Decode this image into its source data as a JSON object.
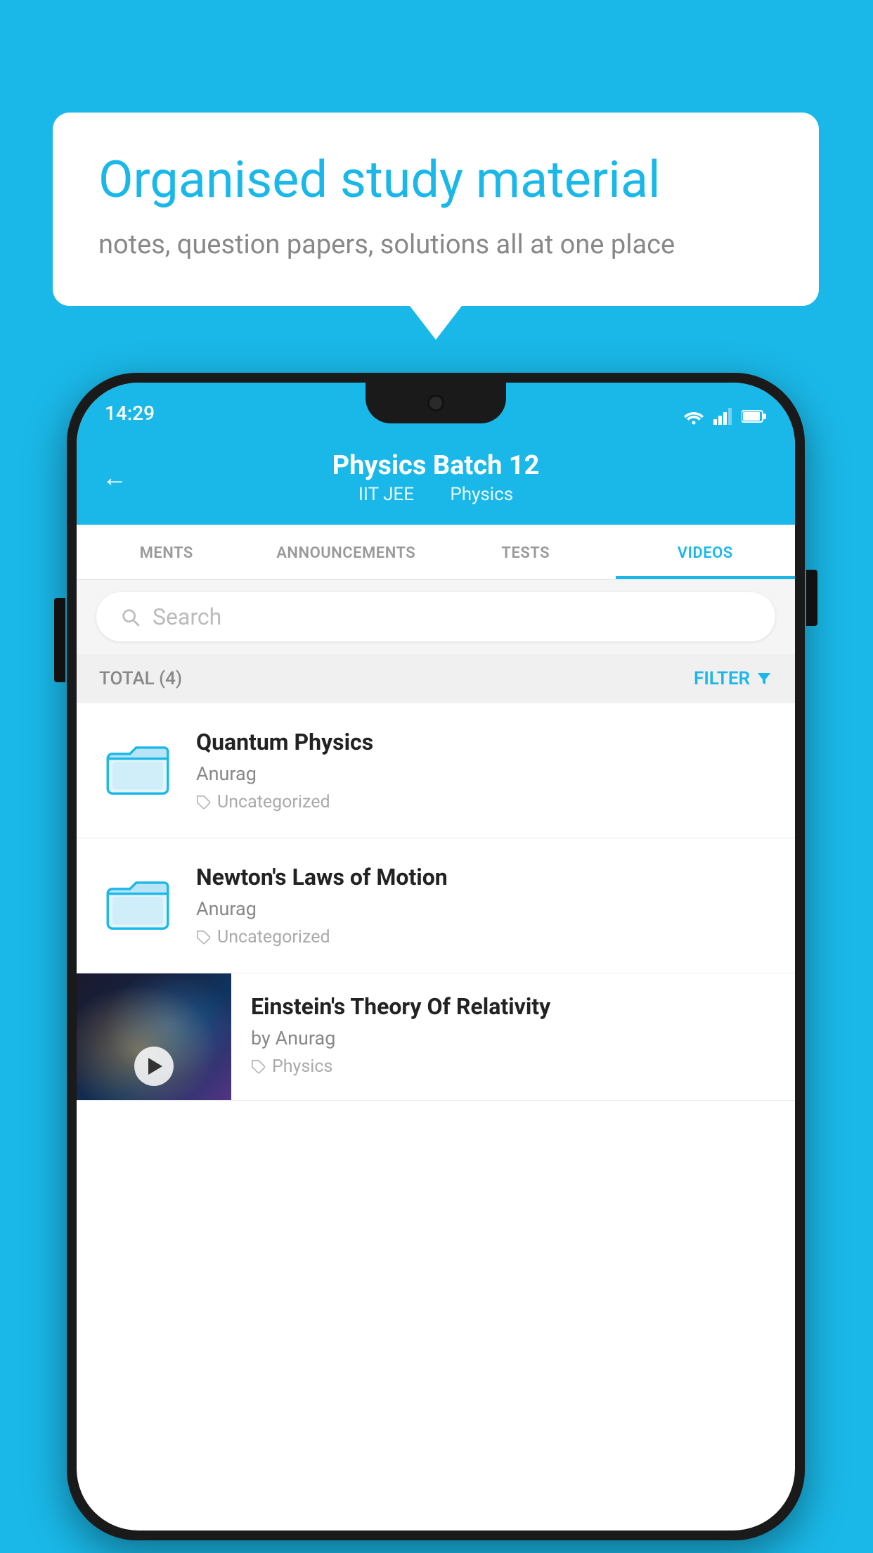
{
  "background_color": "#1ab8e8",
  "speech_bubble": {
    "heading": "Organised study material",
    "subtext": "notes, question papers, solutions all at one place"
  },
  "status_bar": {
    "time": "14:29",
    "wifi": "▼",
    "signal": "▲",
    "battery": "▮"
  },
  "header": {
    "back_label": "←",
    "title": "Physics Batch 12",
    "subtitle_part1": "IIT JEE",
    "subtitle_part2": "Physics"
  },
  "tabs": [
    {
      "label": "MENTS",
      "active": false
    },
    {
      "label": "ANNOUNCEMENTS",
      "active": false
    },
    {
      "label": "TESTS",
      "active": false
    },
    {
      "label": "VIDEOS",
      "active": true
    }
  ],
  "search": {
    "placeholder": "Search"
  },
  "filter_bar": {
    "total_label": "TOTAL (4)",
    "filter_label": "FILTER"
  },
  "videos": [
    {
      "title": "Quantum Physics",
      "author": "Anurag",
      "tag": "Uncategorized",
      "type": "folder"
    },
    {
      "title": "Newton's Laws of Motion",
      "author": "Anurag",
      "tag": "Uncategorized",
      "type": "folder"
    },
    {
      "title": "Einstein's Theory Of Relativity",
      "author": "by Anurag",
      "tag": "Physics",
      "type": "video"
    }
  ]
}
